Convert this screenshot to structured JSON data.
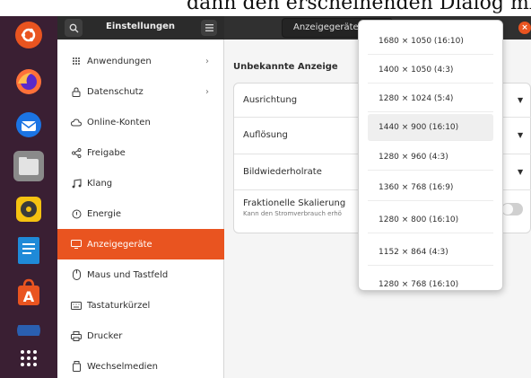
{
  "document": {
    "partial_text": "dann den erscheinenden Dialog mit „Beibehalten"
  },
  "dock": {
    "items": [
      {
        "name": "ubuntu-logo-icon"
      },
      {
        "name": "firefox-icon"
      },
      {
        "name": "thunderbird-icon"
      },
      {
        "name": "files-icon"
      },
      {
        "name": "rhythmbox-icon"
      },
      {
        "name": "writer-icon"
      },
      {
        "name": "software-icon"
      },
      {
        "name": "help-icon"
      },
      {
        "name": "app-grid-icon"
      }
    ]
  },
  "header": {
    "title": "Einstellungen",
    "stack_label": "Anzeigegeräte",
    "close_glyph": "×"
  },
  "sidebar": {
    "items": [
      {
        "label": "Anwendungen",
        "icon": "grid-icon",
        "chevron": "›"
      },
      {
        "label": "Datenschutz",
        "icon": "lock-icon",
        "chevron": "›"
      },
      {
        "label": "Online-Konten",
        "icon": "cloud-icon"
      },
      {
        "label": "Freigabe",
        "icon": "share-icon"
      },
      {
        "label": "Klang",
        "icon": "music-note-icon"
      },
      {
        "label": "Energie",
        "icon": "power-icon"
      },
      {
        "label": "Anzeigegeräte",
        "icon": "display-icon",
        "active": true
      },
      {
        "label": "Maus und Tastfeld",
        "icon": "mouse-icon"
      },
      {
        "label": "Tastaturkürzel",
        "icon": "keyboard-icon"
      },
      {
        "label": "Drucker",
        "icon": "printer-icon"
      },
      {
        "label": "Wechselmedien",
        "icon": "removable-media-icon"
      }
    ]
  },
  "main": {
    "section_title": "Unbekannte Anzeige",
    "rows": [
      {
        "label": "Ausrichtung"
      },
      {
        "label": "Auflösung"
      },
      {
        "label": "Bildwiederholrate"
      },
      {
        "label": "Fraktionelle Skalierung",
        "sub": "Kann den Stromverbrauch erhö"
      }
    ]
  },
  "resolution_menu": {
    "options": [
      "1680 × 1050 (16:10)",
      "1400 × 1050 (4:3)",
      "1280 × 1024 (5:4)",
      "1440 × 900 (16:10)",
      "1280 × 960 (4:3)",
      "1360 × 768 (16:9)",
      "1280 × 800 (16:10)",
      "1152 × 864 (4:3)",
      "1280 × 768 (16:10)"
    ],
    "hovered_index": 3
  },
  "colors": {
    "accent": "#e95420",
    "dock_bg": "#3a1f33",
    "header_bg": "#2b2b2b"
  }
}
